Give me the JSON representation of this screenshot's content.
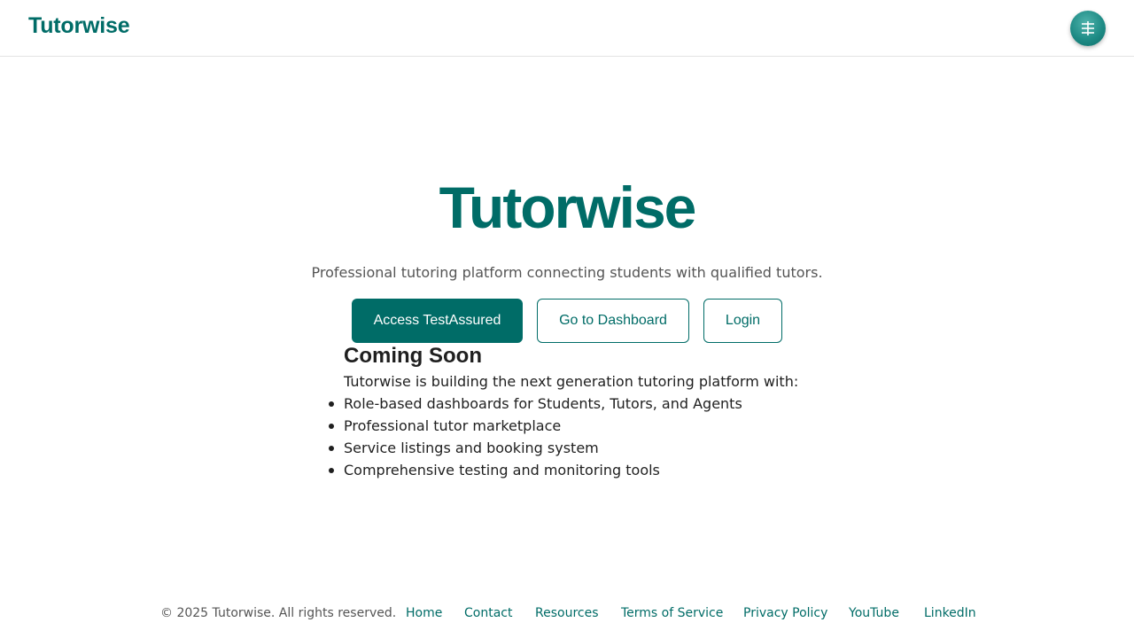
{
  "header": {
    "brand": "Tutorwise"
  },
  "hero": {
    "title": "Tutorwise",
    "tagline": "Professional tutoring platform connecting students with qualified tutors.",
    "buttons": {
      "primary": "Access TestAssured",
      "dashboard": "Go to Dashboard",
      "login": "Login"
    }
  },
  "coming_soon": {
    "heading": "Coming Soon",
    "intro": "Tutorwise is building the next generation tutoring platform with:",
    "features": [
      "Role-based dashboards for Students, Tutors, and Agents",
      "Professional tutor marketplace",
      "Service listings and booking system",
      "Comprehensive testing and monitoring tools"
    ]
  },
  "footer": {
    "copyright": "© 2025 Tutorwise. All rights reserved.",
    "links": [
      "Home",
      "Contact",
      "Resources",
      "Terms of Service",
      "Privacy Policy",
      "YouTube",
      "LinkedIn"
    ]
  },
  "colors": {
    "brand": "#006c67",
    "text": "#1f1f1f",
    "muted": "#555555"
  },
  "icons": {
    "menu": "menu-icon"
  }
}
